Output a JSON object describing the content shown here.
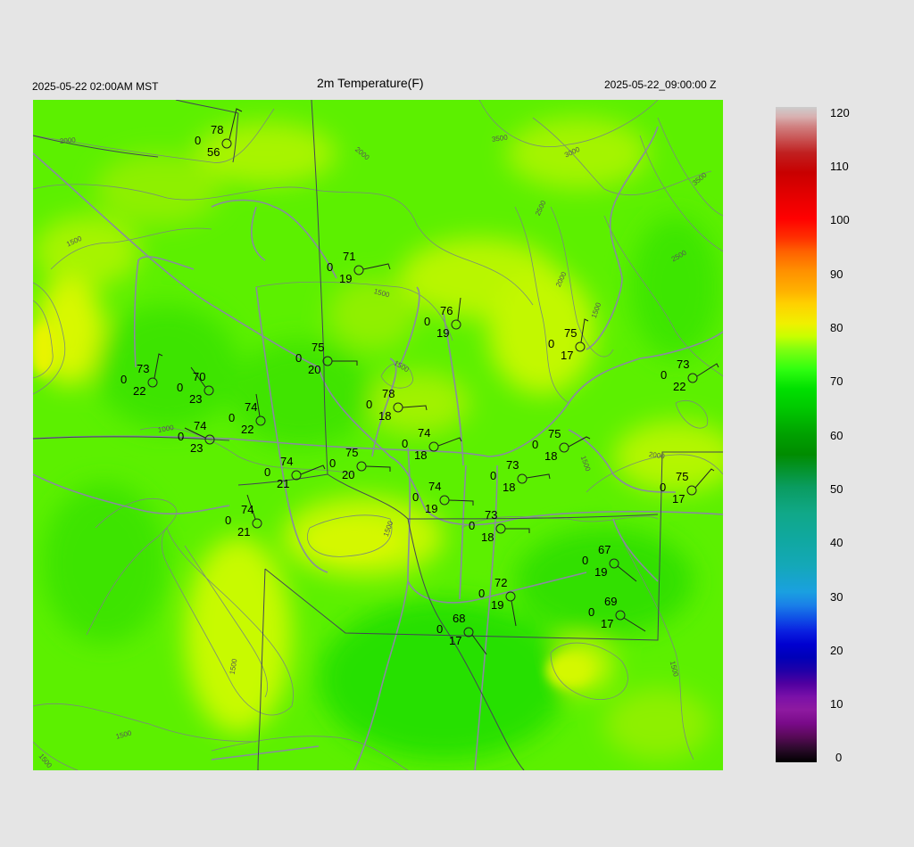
{
  "header": {
    "title": "2m Temperature(F)",
    "local_time": "2025-05-22 02:00AM MST",
    "utc_time": "2025-05-22_09:00:00 Z"
  },
  "colorbar": {
    "ticks": [
      "120",
      "110",
      "100",
      "90",
      "80",
      "70",
      "60",
      "50",
      "40",
      "30",
      "20",
      "10",
      "0"
    ]
  },
  "contour_labels": [
    "2000",
    "2000",
    "3500",
    "3000",
    "3500",
    "2500",
    "2500",
    "2000",
    "1500",
    "1500",
    "1500",
    "1000",
    "1500",
    "2000",
    "1500",
    "1500",
    "1500",
    "1500",
    "1500",
    "1500"
  ],
  "stations": [
    {
      "t": "78",
      "v": "0",
      "d": "56"
    },
    {
      "t": "71",
      "v": "0",
      "d": "19"
    },
    {
      "t": "76",
      "v": "0",
      "d": "19"
    },
    {
      "t": "75",
      "v": "0",
      "d": "17"
    },
    {
      "t": "75",
      "v": "0",
      "d": "20"
    },
    {
      "t": "73",
      "v": "0",
      "d": "22"
    },
    {
      "t": "70",
      "v": "0",
      "d": "23"
    },
    {
      "t": "73",
      "v": "0",
      "d": "22"
    },
    {
      "t": "78",
      "v": "0",
      "d": "18"
    },
    {
      "t": "74",
      "v": "0",
      "d": "22"
    },
    {
      "t": "74",
      "v": "0",
      "d": "23"
    },
    {
      "t": "74",
      "v": "0",
      "d": "18"
    },
    {
      "t": "75",
      "v": "0",
      "d": "18"
    },
    {
      "t": "75",
      "v": "0",
      "d": "20"
    },
    {
      "t": "74",
      "v": "0",
      "d": "21"
    },
    {
      "t": "73",
      "v": "0",
      "d": "18"
    },
    {
      "t": "75",
      "v": "0",
      "d": "17"
    },
    {
      "t": "74",
      "v": "0",
      "d": "19"
    },
    {
      "t": "74",
      "v": "0",
      "d": "21"
    },
    {
      "t": "73",
      "v": "0",
      "d": "18"
    },
    {
      "t": "67",
      "v": "0",
      "d": "19"
    },
    {
      "t": "72",
      "v": "0",
      "d": "19"
    },
    {
      "t": "69",
      "v": "0",
      "d": "17"
    },
    {
      "t": "68",
      "v": "0",
      "d": "17"
    }
  ]
}
